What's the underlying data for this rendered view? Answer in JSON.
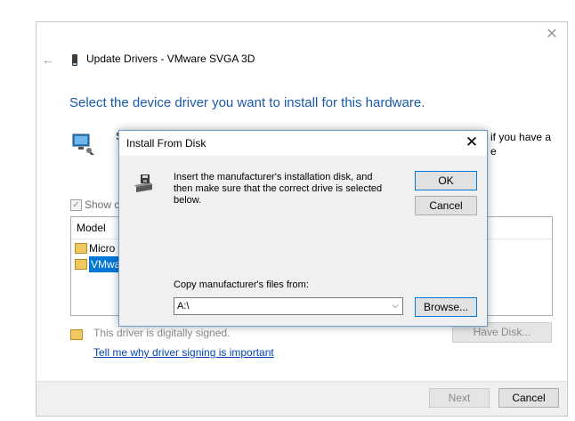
{
  "wizard": {
    "title": "Update Drivers - VMware SVGA 3D",
    "heading": "Select the device driver you want to install for this hardware.",
    "partial_s": "S",
    "right_text_line1": "if you have a",
    "right_text_line2": "e",
    "show_compatible_label": "Show co",
    "model_header": "Model",
    "models": [
      "Micro",
      "VMwa"
    ],
    "signed_text": "This driver is digitally signed.",
    "signing_link": "Tell me why driver signing is important",
    "have_disk_label": "Have Disk...",
    "next_label": "Next",
    "cancel_label": "Cancel"
  },
  "dialog": {
    "title": "Install From Disk",
    "instruction": "Insert the manufacturer's installation disk, and then make sure that the correct drive is selected below.",
    "ok_label": "OK",
    "cancel_label": "Cancel",
    "copy_label": "Copy manufacturer's files from:",
    "path_value": "A:\\",
    "browse_label": "Browse..."
  },
  "icons": {
    "close": "close-icon",
    "back": "back-arrow-icon",
    "disk": "disk-drive-icon",
    "hardware": "monitor-icon"
  },
  "colors": {
    "heading": "#1a5aa8",
    "link": "#0645ad",
    "selection": "#0078d7",
    "dialog_border": "#6e9bd1"
  }
}
